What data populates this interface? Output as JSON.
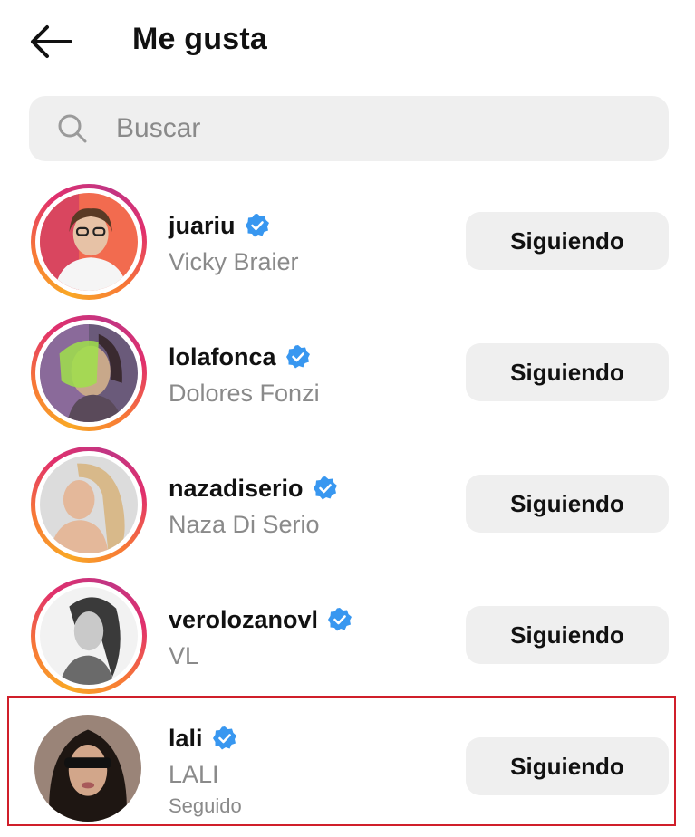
{
  "header": {
    "title": "Me gusta",
    "back_icon": "arrow-left-icon"
  },
  "search": {
    "placeholder": "Buscar",
    "value": "",
    "icon": "search-icon"
  },
  "accounts": [
    {
      "username": "juariu",
      "full_name": "Vicky Braier",
      "verified": true,
      "story_ring": true,
      "button_label": "Siguiendo"
    },
    {
      "username": "lolafonca",
      "full_name": "Dolores Fonzi",
      "verified": true,
      "story_ring": true,
      "button_label": "Siguiendo"
    },
    {
      "username": "nazadiserio",
      "full_name": "Naza Di Serio",
      "verified": true,
      "story_ring": true,
      "button_label": "Siguiendo"
    },
    {
      "username": "verolozanovl",
      "full_name": "VL",
      "verified": true,
      "story_ring": true,
      "button_label": "Siguiendo"
    },
    {
      "username": "lali",
      "full_name": "LALI",
      "subtitle": "Seguido",
      "verified": true,
      "story_ring": false,
      "button_label": "Siguiendo",
      "highlighted": true
    }
  ],
  "colors": {
    "verified_blue": "#3897f0",
    "button_bg": "#efefef",
    "highlight_border": "#d01f2a",
    "secondary_text": "#8a8a8a"
  }
}
